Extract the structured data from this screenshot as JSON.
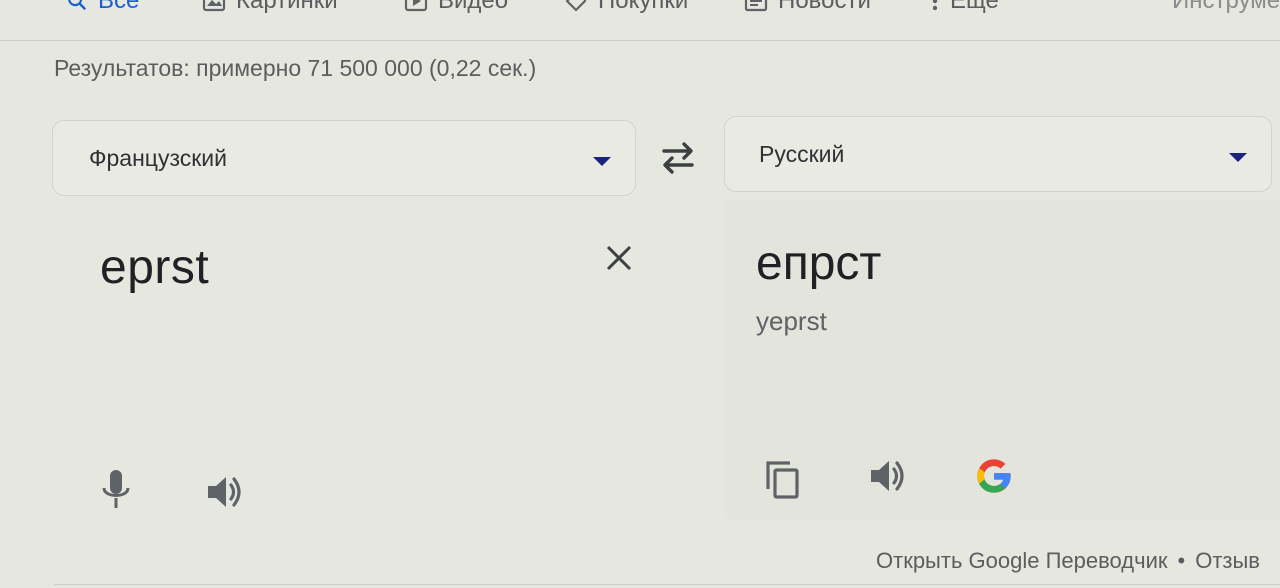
{
  "tabs": [
    {
      "label": "Все",
      "icon": "search-icon",
      "active": true
    },
    {
      "label": "Картинки",
      "icon": "image-icon"
    },
    {
      "label": "Видео",
      "icon": "play-icon"
    },
    {
      "label": "Покупки",
      "icon": "tag-icon"
    },
    {
      "label": "Новости",
      "icon": "news-icon"
    },
    {
      "label": "Еще",
      "icon": "more-vert-icon"
    },
    {
      "label": "Инструме"
    }
  ],
  "result_stats": "Результатов: примерно 71 500 000 (0,22 сек.)",
  "translator": {
    "source_lang": "Французский",
    "target_lang": "Русский",
    "source_text": "eprst",
    "translated_text": "епрст",
    "transliteration": "yeprst"
  },
  "footer": {
    "open_translator": "Открыть Google Переводчик",
    "separator": "•",
    "feedback": "Отзыв"
  },
  "colors": {
    "background": "#e6e7df",
    "accent": "#1a5fd0",
    "caret": "#1a237e",
    "icon_gray": "#5f6368"
  }
}
